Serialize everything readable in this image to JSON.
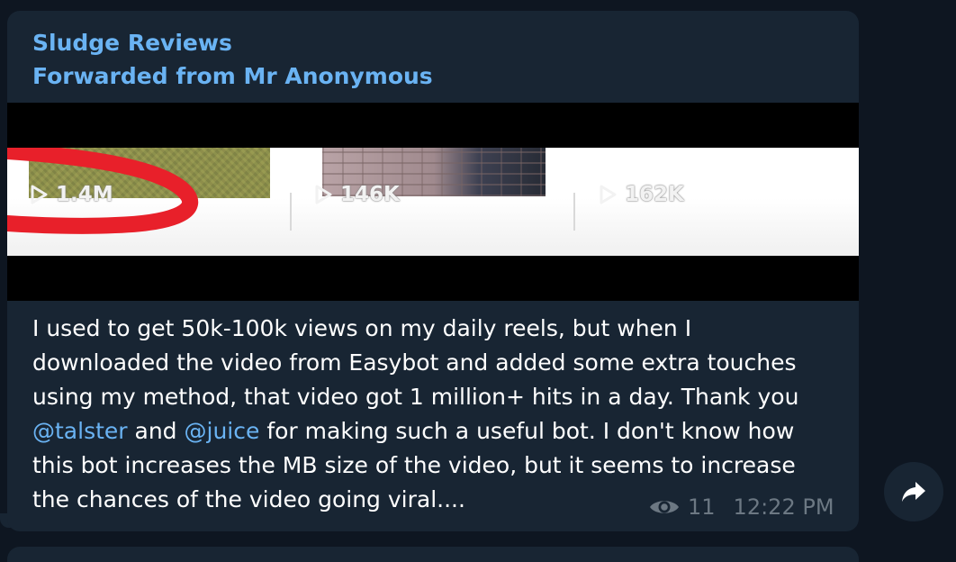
{
  "channel": {
    "name": "Sludge Reviews",
    "forwarded_from": "Forwarded from Mr Anonymous"
  },
  "media": {
    "views": [
      {
        "label": "1.4M",
        "icon": "play-icon"
      },
      {
        "label": "146K",
        "icon": "play-icon"
      },
      {
        "label": "162K",
        "icon": "play-icon"
      }
    ]
  },
  "message": {
    "line1": "I used to get 50k-100k views on my daily reels, but when I",
    "line2": "downloaded the video from Easybot and added some extra touches",
    "line3": "using my method, that video got 1 million+ hits in a day. Thank you",
    "mention1": "@talster",
    "line4_mid": " and ",
    "mention2": "@juice",
    "line4_end": " for making such a useful bot. I don't know how",
    "line5": "this bot increases the MB size of the video, but it seems to increase",
    "line6": "the chances of the video going viral...."
  },
  "meta": {
    "views": "11",
    "time": "12:22 PM",
    "view_icon": "eye-icon"
  },
  "share": {
    "icon": "share-arrow-icon"
  },
  "colors": {
    "background": "#0e1621",
    "bubble": "#182533",
    "accent": "#6ab3f3",
    "meta": "#6c7883"
  }
}
